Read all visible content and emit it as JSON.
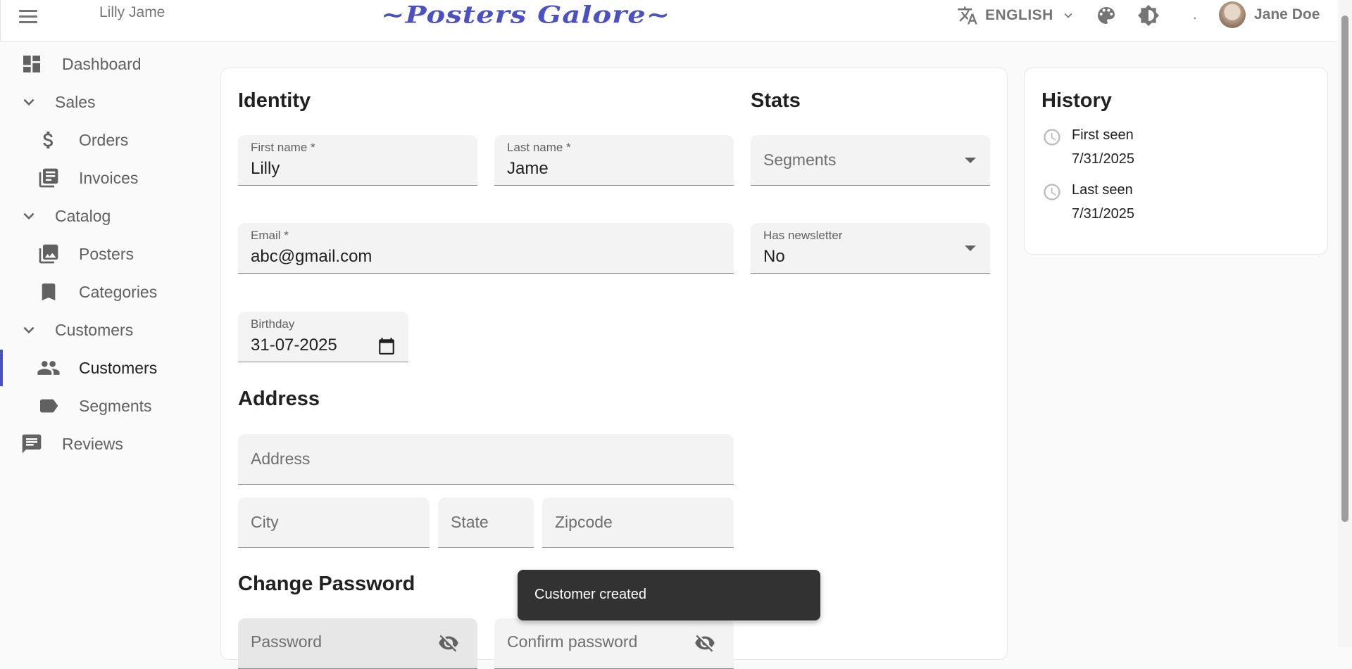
{
  "header": {
    "page_name": "Lilly Jame",
    "brand": "~Posters Galore~",
    "language": "ENGLISH",
    "dot": ".",
    "user_name": "Jane Doe"
  },
  "sidebar": {
    "items": [
      {
        "label": "Dashboard"
      },
      {
        "label": "Sales"
      },
      {
        "label": "Orders"
      },
      {
        "label": "Invoices"
      },
      {
        "label": "Catalog"
      },
      {
        "label": "Posters"
      },
      {
        "label": "Categories"
      },
      {
        "label": "Customers"
      },
      {
        "label": "Customers"
      },
      {
        "label": "Segments"
      },
      {
        "label": "Reviews"
      }
    ],
    "active": "Customers",
    "accent": "#4b51c0"
  },
  "identity": {
    "title": "Identity",
    "first_name_label": "First name *",
    "first_name_value": "Lilly",
    "last_name_label": "Last name *",
    "last_name_value": "Jame",
    "email_label": "Email *",
    "email_value": "abc@gmail.com",
    "birthday_label": "Birthday",
    "birthday_value": "31-07-2025"
  },
  "stats": {
    "title": "Stats",
    "segments_placeholder": "Segments",
    "newsletter_label": "Has newsletter",
    "newsletter_value": "No"
  },
  "address": {
    "title": "Address",
    "address_placeholder": "Address",
    "city_placeholder": "City",
    "state_placeholder": "State",
    "zipcode_placeholder": "Zipcode"
  },
  "password": {
    "title": "Change Password",
    "password_placeholder": "Password",
    "confirm_placeholder": "Confirm password"
  },
  "history": {
    "title": "History",
    "first_seen_label": "First seen",
    "first_seen_value": "7/31/2025",
    "last_seen_label": "Last seen",
    "last_seen_value": "7/31/2025"
  },
  "toast": {
    "message": "Customer created"
  }
}
